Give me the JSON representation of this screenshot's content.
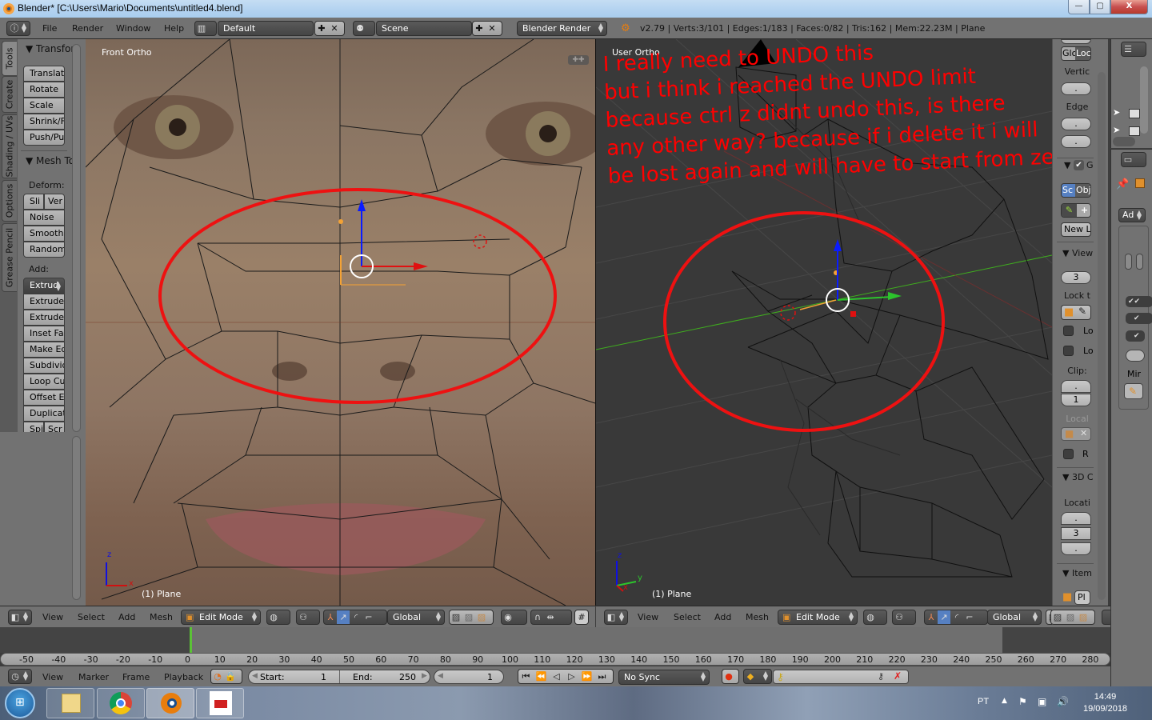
{
  "window": {
    "title": "Blender* [C:\\Users\\Mario\\Documents\\untitled4.blend]",
    "minimize": "—",
    "maximize": "▢",
    "close": "X"
  },
  "info_header": {
    "editor_icon": "info-icon",
    "menus": [
      "File",
      "Render",
      "Window",
      "Help"
    ],
    "screen_layout": "Default",
    "scene": "Scene",
    "render_engine": "Blender Render",
    "stats": "v2.79 | Verts:3/101 | Edges:1/183 | Faces:0/82 | Tris:162 | Mem:22.23M | Plane"
  },
  "toolshelf": {
    "tabs": [
      "Tools",
      "Create",
      "Shading / UVs",
      "Options",
      "Grease Pencil"
    ],
    "active_tab": "Tools",
    "transform_header": "Transfor",
    "transform_buttons": [
      "Translat",
      "Rotate",
      "Scale",
      "Shrink/F",
      "Push/Pull"
    ],
    "mesh_tools_header": "Mesh To",
    "deform_label": "Deform:",
    "deform_row": [
      "Sli",
      "Ver"
    ],
    "deform_buttons": [
      "Noise",
      "Smooth",
      "Randomi"
    ],
    "add_label": "Add:",
    "add_dropdown": "Extrud",
    "add_buttons": [
      "Extrude",
      "Extrude I",
      "Inset Fa",
      "Make Ed",
      "Subdivid",
      "Loop Cut",
      "Offset Ed",
      "Duplicat"
    ],
    "last_row": [
      "Spi",
      "Scr"
    ]
  },
  "viewport_left": {
    "view_name": "Front Ortho",
    "object_label": "(1) Plane",
    "axes": {
      "z": "z",
      "x": "x"
    }
  },
  "viewport_right": {
    "view_name": "User Ortho",
    "object_label": "(1) Plane",
    "axes": {
      "z": "z",
      "y": "y",
      "x": "x"
    },
    "annotation_lines": [
      "I really need to UNDO this",
      "but i think i reached the UNDO limit",
      "because ctrl z didnt undo this, is there",
      "any other way? because if i delete it i will",
      "be lost again and will have to start from zero."
    ],
    "annotation_color": "#ff0000"
  },
  "npanel": {
    "glo": "Glo",
    "loc": "Loc",
    "vertex_label": "Vertic",
    "vertex_value": ".",
    "edge_label": "Edge",
    "edge_values": [
      ".",
      "."
    ],
    "grease_header": "G",
    "scene_btn": "Sc",
    "object_btn": "Obj",
    "new_layer": "New L",
    "view_header": "View",
    "lens_value": "3",
    "lock_label": "Lock t",
    "lock_checks": [
      "Lo",
      "Lo"
    ],
    "clip_label": "Clip:",
    "clip_values": [
      ".",
      "1"
    ],
    "local_label": "Local",
    "r_check": "R",
    "cursor_header": "3D C",
    "location_label": "Locati",
    "location_values": [
      ".",
      "3",
      "."
    ],
    "item_header": "Item",
    "item_name": "Pl"
  },
  "properties": {
    "dropdown": "Ad",
    "mirror_label": "Mir"
  },
  "viewport_header": {
    "menus": [
      "View",
      "Select",
      "Add",
      "Mesh"
    ],
    "mode": "Edit Mode",
    "orientation": "Global"
  },
  "timeline": {
    "ticks": [
      "-50",
      "-40",
      "-30",
      "-20",
      "-10",
      "0",
      "10",
      "20",
      "30",
      "40",
      "50",
      "60",
      "70",
      "80",
      "90",
      "100",
      "110",
      "120",
      "130",
      "140",
      "150",
      "160",
      "170",
      "180",
      "190",
      "200",
      "210",
      "220",
      "230",
      "240",
      "250",
      "260",
      "270",
      "280"
    ],
    "menus": [
      "View",
      "Marker",
      "Frame",
      "Playback"
    ],
    "start_label": "Start:",
    "start_value": "1",
    "end_label": "End:",
    "end_value": "250",
    "current_frame": "1",
    "sync": "No Sync",
    "current_frame_color": "#5bc236"
  },
  "taskbar": {
    "apps": [
      "windows-explorer",
      "google-chrome",
      "blender",
      "app-icon"
    ],
    "language": "PT",
    "time": "14:49",
    "date": "19/09/2018"
  }
}
